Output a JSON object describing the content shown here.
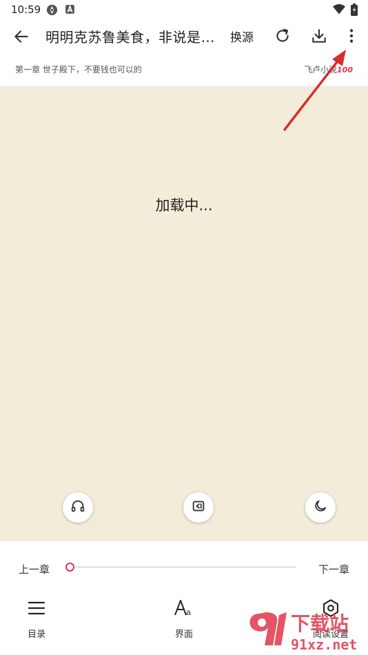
{
  "status_bar": {
    "time": "10:59"
  },
  "toolbar": {
    "title": "明明克苏鲁美食，非说是黑暗料理",
    "source_label": "换源",
    "icons": [
      "back-arrow-icon",
      "refresh-icon",
      "download-icon",
      "more-vert-icon"
    ]
  },
  "chapter_bar": {
    "chapter": "第一章 世子殿下，不要钱也可以的",
    "site": "飞卢小说",
    "site_badge": "100"
  },
  "reader": {
    "loading_text": "加载中...",
    "background": "#f3ecd9",
    "fab_icons": [
      "headphones-icon",
      "auto-page-icon",
      "night-mode-icon"
    ]
  },
  "bottom": {
    "prev_label": "上一章",
    "next_label": "下一章",
    "progress": 0,
    "accent": "#e0374b",
    "nav": [
      {
        "label": "目录",
        "icon": "menu-list-icon"
      },
      {
        "label": "界面",
        "icon": "font-size-icon"
      },
      {
        "label": "阅读设置",
        "icon": "settings-icon"
      }
    ]
  },
  "watermark": {
    "text_top": "下载站",
    "text_bottom": "91xz.net"
  }
}
